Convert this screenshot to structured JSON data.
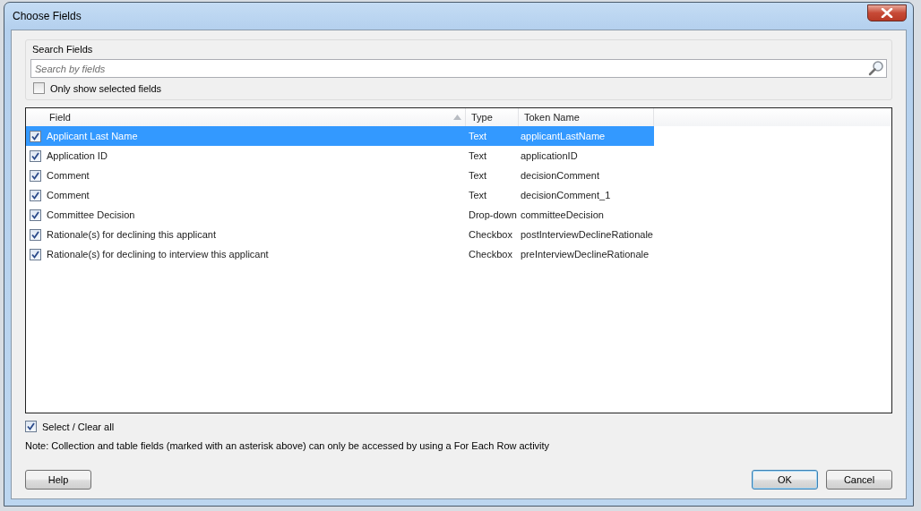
{
  "window": {
    "title": "Choose Fields"
  },
  "search": {
    "group_label": "Search Fields",
    "placeholder": "Search by fields",
    "only_selected_label": "Only show selected fields",
    "only_selected_checked": false
  },
  "table": {
    "columns": [
      "Field",
      "Type",
      "Token Name"
    ],
    "rows": [
      {
        "field": "Applicant Last Name",
        "type": "Text",
        "token": "applicantLastName",
        "checked": true,
        "selected": true
      },
      {
        "field": "Application ID",
        "type": "Text",
        "token": "applicationID",
        "checked": true,
        "selected": false
      },
      {
        "field": "Comment",
        "type": "Text",
        "token": "decisionComment",
        "checked": true,
        "selected": false
      },
      {
        "field": "Comment",
        "type": "Text",
        "token": "decisionComment_1",
        "checked": true,
        "selected": false
      },
      {
        "field": "Committee Decision",
        "type": "Drop-down",
        "token": "committeeDecision",
        "checked": true,
        "selected": false
      },
      {
        "field": "Rationale(s) for declining this applicant",
        "type": "Checkbox",
        "token": "postInterviewDeclineRationale",
        "checked": true,
        "selected": false
      },
      {
        "field": "Rationale(s) for declining to interview this applicant",
        "type": "Checkbox",
        "token": "preInterviewDeclineRationale",
        "checked": true,
        "selected": false
      }
    ]
  },
  "select_all": {
    "label": "Select / Clear all",
    "checked": true
  },
  "note": "Note: Collection and table fields (marked with an asterisk above) can only be accessed by using a For Each Row activity",
  "buttons": {
    "help": "Help",
    "ok": "OK",
    "cancel": "Cancel"
  }
}
